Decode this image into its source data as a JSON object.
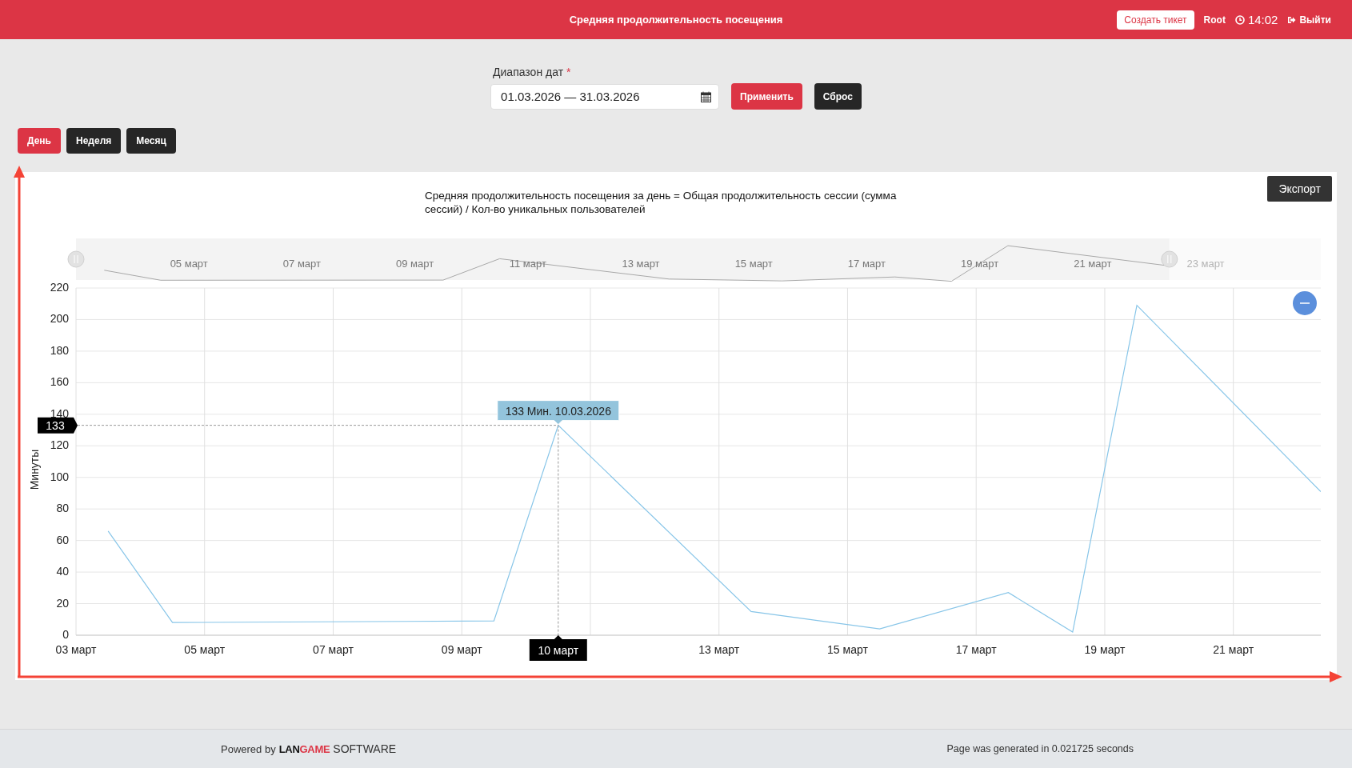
{
  "header": {
    "title": "Средняя продолжительность посещения",
    "create_ticket": "Создать тикет",
    "user": "Root",
    "time": "14:02",
    "logout": "Выйти"
  },
  "filter": {
    "label": "Диапазон дат",
    "required_mark": "*",
    "value": "01.03.2026 — 31.03.2026",
    "apply": "Применить",
    "reset": "Сброс"
  },
  "periods": [
    {
      "label": "День",
      "selected": true
    },
    {
      "label": "Неделя",
      "selected": false
    },
    {
      "label": "Месяц",
      "selected": false
    }
  ],
  "chart": {
    "description": "Средняя продолжительность посещения за день = Общая продолжительность сессии (сумма сессий) / Кол-во уникальных пользователей",
    "export": "Экспорт",
    "navigator": {
      "labels": [
        {
          "text": "05 март",
          "in_range": true
        },
        {
          "text": "07 март",
          "in_range": true
        },
        {
          "text": "09 март",
          "in_range": true
        },
        {
          "text": "11 март",
          "in_range": true
        },
        {
          "text": "13 март",
          "in_range": true
        },
        {
          "text": "15 март",
          "in_range": true
        },
        {
          "text": "17 март",
          "in_range": true
        },
        {
          "text": "19 март",
          "in_range": true
        },
        {
          "text": "21 март",
          "in_range": true
        },
        {
          "text": "23 март",
          "in_range": false
        }
      ]
    },
    "chart_data": {
      "type": "line",
      "ylabel": "Минуты",
      "x": [
        3.5,
        4.5,
        9.5,
        10.5,
        13.5,
        15.5,
        17.5,
        18.5,
        19.5,
        22.36
      ],
      "series": [
        {
          "color": "#87c5e8",
          "values": [
            66,
            8,
            9,
            133,
            15,
            4,
            27,
            2,
            209,
            91
          ]
        }
      ],
      "xlim": [
        3,
        22.36
      ],
      "ylim": [
        0,
        220
      ],
      "xticks": [
        {
          "value": 3,
          "label": "03 март"
        },
        {
          "value": 5,
          "label": "05 март"
        },
        {
          "value": 7,
          "label": "07 март"
        },
        {
          "value": 9,
          "label": "09 март"
        },
        {
          "value": 13,
          "label": "13 март"
        },
        {
          "value": 15,
          "label": "15 март"
        },
        {
          "value": 17,
          "label": "17 март"
        },
        {
          "value": 19,
          "label": "19 март"
        },
        {
          "value": 21,
          "label": "21 март"
        }
      ],
      "yticks": [
        0,
        20,
        40,
        60,
        80,
        100,
        120,
        140,
        160,
        180,
        200,
        220
      ],
      "grid": true,
      "annotations": [
        {
          "x": 10.5,
          "y": 133,
          "text": "133 Мин. 10.03.2026"
        }
      ]
    },
    "crosshair": {
      "x_label": "10 март",
      "y_label": "133"
    }
  },
  "footer": {
    "powered": "Powered by",
    "logo": [
      {
        "text": "LAN",
        "color": "#111111"
      },
      {
        "text": "GAME",
        "color": "#dc3545"
      }
    ],
    "suffix": "SOFTWARE",
    "generated": "Page was generated in 0.021725 seconds"
  }
}
